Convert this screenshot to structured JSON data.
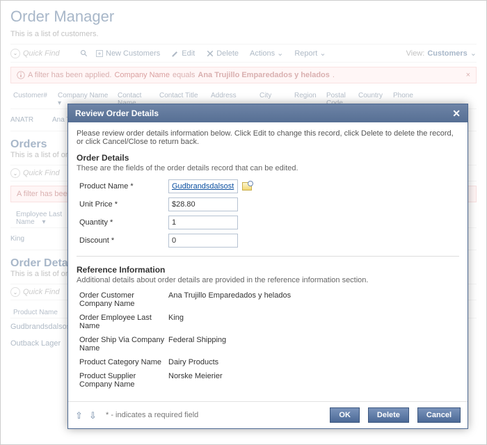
{
  "page": {
    "title": "Order Manager",
    "subtitle": "This is a list of customers."
  },
  "toolbar": {
    "quick_find": "Quick Find",
    "new_customers": "New Customers",
    "edit": "Edit",
    "delete": "Delete",
    "actions": "Actions",
    "report": "Report",
    "view_label": "View:",
    "view_value": "Customers"
  },
  "filterbar": {
    "text1": "A filter has been applied.",
    "field": "Company Name",
    "op": "equals",
    "value": "Ana Trujillo Emparedados y helados",
    "suffix": "."
  },
  "columns": [
    "Customer#",
    "Company Name",
    "Contact Name",
    "Contact Title",
    "Address",
    "City",
    "Region",
    "Postal Code",
    "Country",
    "Phone"
  ],
  "row1": {
    "id": "ANATR",
    "name": "Ana Trujillo ..."
  },
  "orders": {
    "heading": "Orders",
    "sub": "This is a list of orders.",
    "filter_trunc": "A filter has been applied.",
    "col1a": "Employee Last",
    "col1b": "Name",
    "val1": "King"
  },
  "details": {
    "heading": "Order Details",
    "sub": "This is a list of order details."
  },
  "detail_rows": {
    "col": "Product Name",
    "r1": "Gudbrandsdalsost",
    "r2": "Outback Lager"
  },
  "modal": {
    "title": "Review Order Details",
    "intro": "Please review order details information below. Click Edit to change this record, click Delete to delete the record, or click Cancel/Close to return back.",
    "group1_h": "Order Details",
    "group1_s": "These are the fields of the order details record that can be edited.",
    "labels": {
      "product_name": "Product Name *",
      "unit_price": "Unit Price *",
      "quantity": "Quantity *",
      "discount": "Discount *"
    },
    "values": {
      "product_name": "Gudbrandsdalsost",
      "unit_price": "$28.80",
      "quantity": "1",
      "discount": "0"
    },
    "group2_h": "Reference Information",
    "group2_s": "Additional details about order details are provided in the reference information section.",
    "ref": {
      "l_cust": "Order Customer Company Name",
      "v_cust": "Ana Trujillo Emparedados y helados",
      "l_emp": "Order Employee Last Name",
      "v_emp": "King",
      "l_ship": "Order Ship Via Company Name",
      "v_ship": "Federal Shipping",
      "l_cat": "Product Category Name",
      "v_cat": "Dairy Products",
      "l_sup": "Product Supplier Company Name",
      "v_sup": "Norske Meierier"
    },
    "req": "* - indicates a required field",
    "btn_ok": "OK",
    "btn_delete": "Delete",
    "btn_cancel": "Cancel"
  }
}
